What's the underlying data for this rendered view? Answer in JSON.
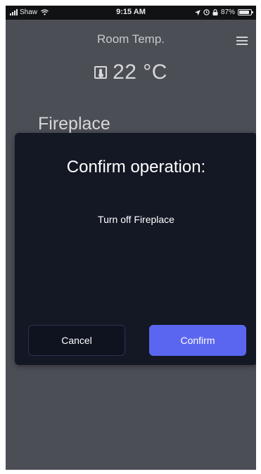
{
  "status_bar": {
    "carrier": "Shaw",
    "time": "9:15 AM",
    "battery": "87%",
    "battery_level": 0.87,
    "icons": [
      "signal-icon",
      "wifi-icon",
      "location-icon",
      "alarm-icon",
      "lock-icon",
      "battery-icon"
    ]
  },
  "header": {
    "room_label": "Room Temp.",
    "temperature": "22 °C",
    "menu_icon": "hamburger-menu-icon",
    "temp_icon": "thermometer-icon"
  },
  "device": {
    "name": "Fireplace"
  },
  "dialog": {
    "title": "Confirm operation:",
    "message": "Turn off Fireplace",
    "cancel_label": "Cancel",
    "confirm_label": "Confirm"
  },
  "colors": {
    "background": "#4b4e55",
    "status_bar": "#111214",
    "dialog_bg": "#141824",
    "confirm_button": "#5b66f0",
    "cancel_border": "#2a3352"
  }
}
